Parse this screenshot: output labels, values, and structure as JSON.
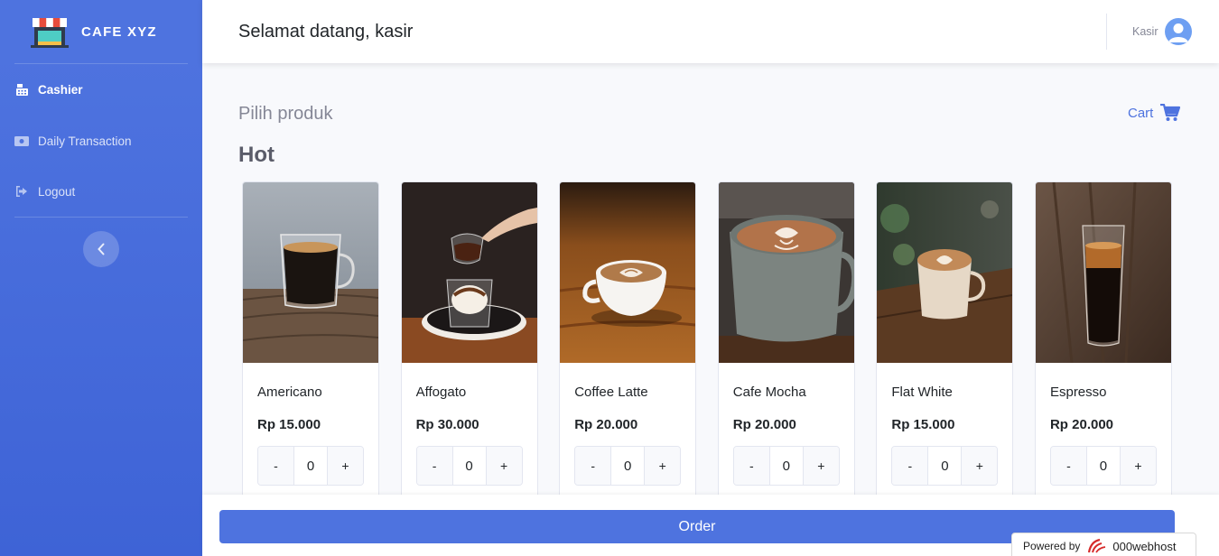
{
  "brand": {
    "name": "CAFE XYZ",
    "icon": "store-icon"
  },
  "sidebar": {
    "items": [
      {
        "label": "Cashier",
        "icon": "cash-register-icon",
        "active": true
      },
      {
        "label": "Daily Transaction",
        "icon": "money-bill-icon",
        "active": false
      },
      {
        "label": "Logout",
        "icon": "sign-out-icon",
        "active": false
      }
    ],
    "toggle_icon": "chevron-left-icon"
  },
  "topbar": {
    "welcome": "Selamat datang, kasir",
    "user_name": "Kasir",
    "avatar_icon": "user-circle-icon"
  },
  "main": {
    "section_title": "Pilih produk",
    "cart_label": "Cart",
    "cart_icon": "shopping-cart-icon",
    "category": "Hot",
    "products": [
      {
        "name": "Americano",
        "price": "Rp 15.000",
        "qty": "0",
        "minus": "-",
        "plus": "+"
      },
      {
        "name": "Affogato",
        "price": "Rp 30.000",
        "qty": "0",
        "minus": "-",
        "plus": "+"
      },
      {
        "name": "Coffee Latte",
        "price": "Rp 20.000",
        "qty": "0",
        "minus": "-",
        "plus": "+"
      },
      {
        "name": "Cafe Mocha",
        "price": "Rp 20.000",
        "qty": "0",
        "minus": "-",
        "plus": "+"
      },
      {
        "name": "Flat White",
        "price": "Rp 15.000",
        "qty": "0",
        "minus": "-",
        "plus": "+"
      },
      {
        "name": "Espresso",
        "price": "Rp 20.000",
        "qty": "0",
        "minus": "-",
        "plus": "+"
      }
    ]
  },
  "footer": {
    "order_label": "Order",
    "powered_by": "Powered by",
    "host_name": "000webhost"
  },
  "colors": {
    "primary": "#4e73df",
    "sidebar": "#4e73df",
    "text_muted": "#858796"
  }
}
